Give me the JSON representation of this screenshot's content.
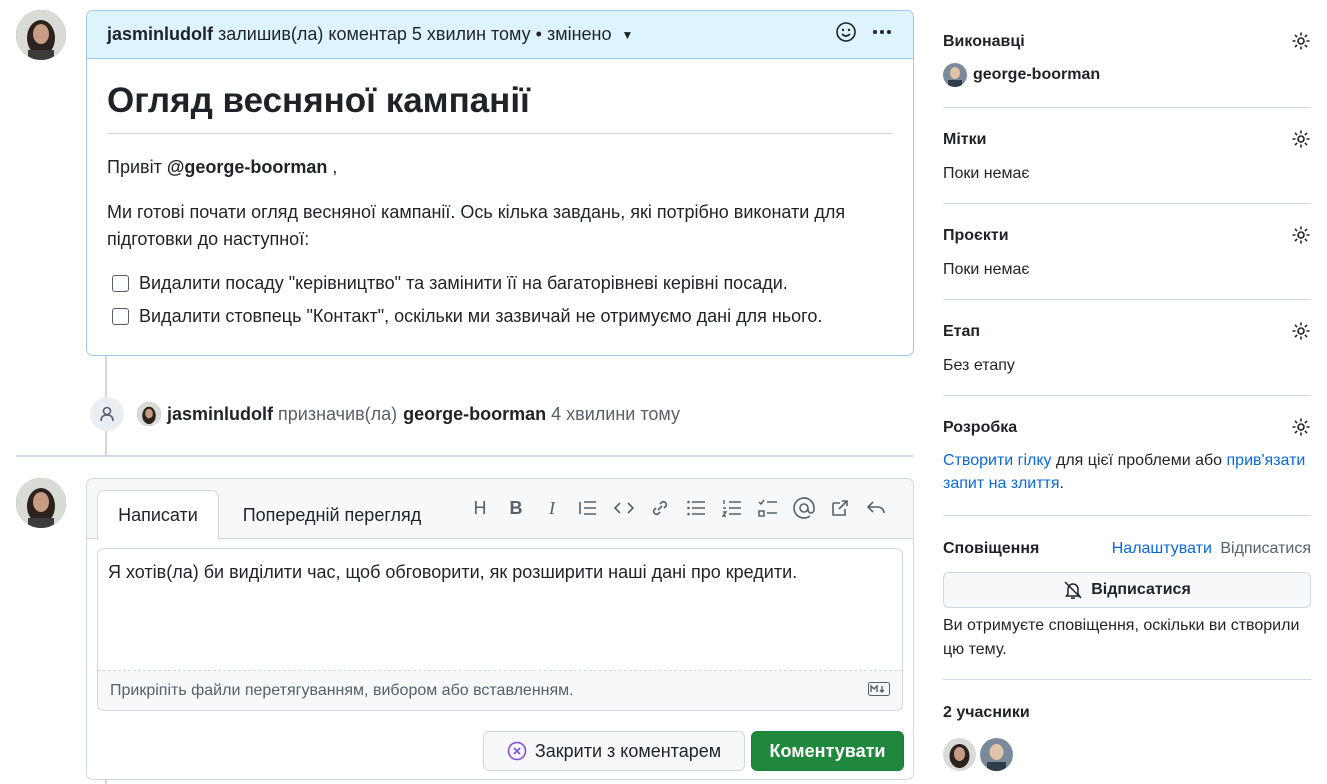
{
  "comment": {
    "author": "jasminludolf",
    "meta": "залишив(ла) коментар 5 хвилин тому • змінено",
    "title": "Огляд весняної кампанії",
    "greeting_prefix": "Привіт",
    "greeting_mention": "@george-boorman",
    "greeting_suffix": ",",
    "paragraph": "Ми готові почати огляд весняної кампанії. Ось кілька завдань, які потрібно виконати для підготовки до наступної:",
    "tasks": [
      "Видалити посаду \"керівництво\" та замінити її на багаторівневі керівні посади.",
      "Видалити стовпець \"Контакт\", оскільки ми зазвичай не отримуємо дані для нього."
    ]
  },
  "event": {
    "actor": "jasminludolf",
    "action": "призначив(ла)",
    "target": "george-boorman",
    "time": "4 хвилини тому"
  },
  "composer": {
    "tab_write": "Написати",
    "tab_preview": "Попередній перегляд",
    "text": "Я хотів(ла) би виділити час, щоб обговорити, як розширити наші дані про кредити.",
    "attach_hint": "Прикріпіть файли перетягуванням, вибором або вставленням.",
    "close_label": "Закрити з коментарем",
    "comment_label": "Коментувати"
  },
  "sidebar": {
    "assignees": {
      "title": "Виконавці",
      "user": "george-boorman"
    },
    "labels": {
      "title": "Мітки",
      "value": "Поки немає"
    },
    "projects": {
      "title": "Проєкти",
      "value": "Поки немає"
    },
    "milestone": {
      "title": "Етап",
      "value": "Без етапу"
    },
    "development": {
      "title": "Розробка",
      "link1": "Створити гілку",
      "text": " для цієї проблеми або ",
      "link2": "прив'язати запит на злиття",
      "end": "."
    },
    "notifications": {
      "title": "Сповіщення",
      "customize": "Налаштувати",
      "unsubscribe_link": "Відписатися",
      "button": "Відписатися",
      "text": "Ви отримуєте сповіщення, оскільки ви створили цю тему."
    },
    "participants": {
      "title": "2 учасники"
    }
  }
}
